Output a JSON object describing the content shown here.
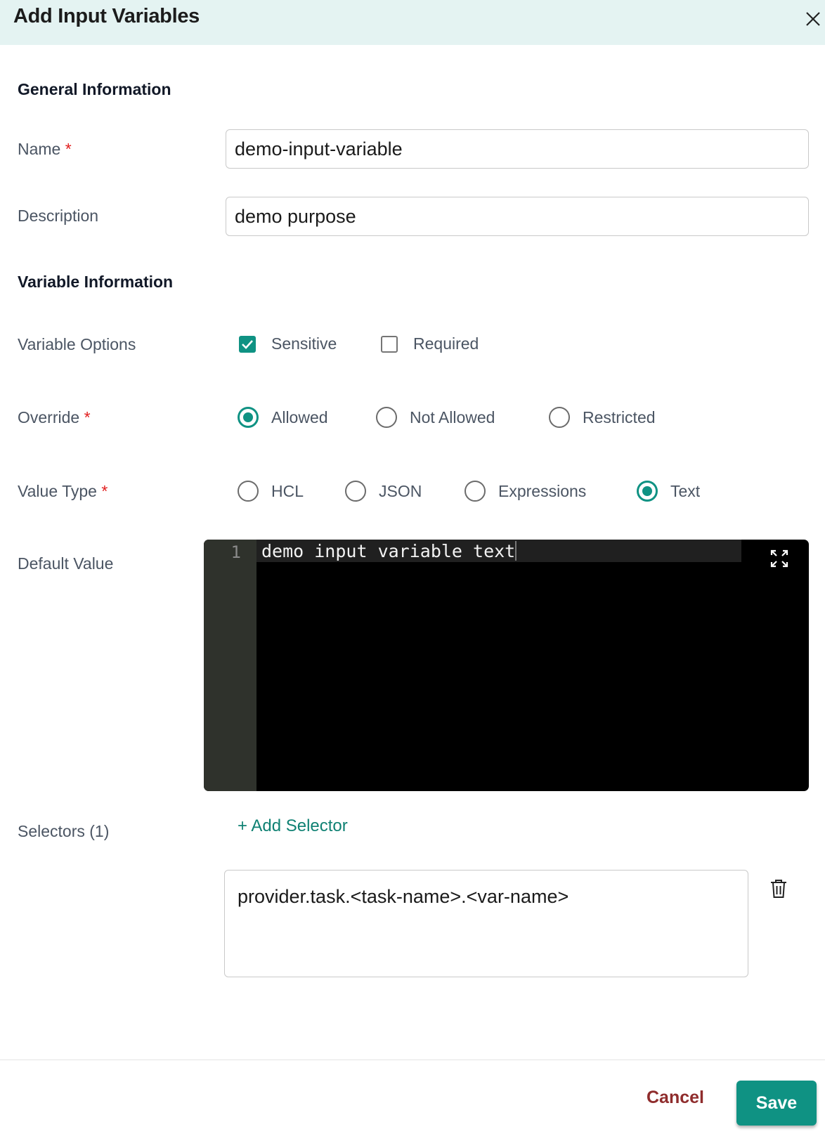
{
  "dialog": {
    "title": "Add Input Variables"
  },
  "general": {
    "heading": "General Information",
    "name_label": "Name",
    "name_value": "demo-input-variable",
    "description_label": "Description",
    "description_value": "demo purpose"
  },
  "variable": {
    "heading": "Variable Information",
    "options_label": "Variable Options",
    "options": [
      {
        "label": "Sensitive",
        "checked": true
      },
      {
        "label": "Required",
        "checked": false
      }
    ],
    "override_label": "Override",
    "override_options": [
      {
        "label": "Allowed",
        "selected": true
      },
      {
        "label": "Not Allowed",
        "selected": false
      },
      {
        "label": "Restricted",
        "selected": false
      }
    ],
    "value_type_label": "Value Type",
    "value_type_options": [
      {
        "label": "HCL",
        "selected": false
      },
      {
        "label": "JSON",
        "selected": false
      },
      {
        "label": "Expressions",
        "selected": false
      },
      {
        "label": "Text",
        "selected": true
      }
    ],
    "default_value_label": "Default Value",
    "editor": {
      "line_number": "1",
      "code": "demo input variable text"
    }
  },
  "selectors": {
    "label": "Selectors (1)",
    "add_label": "+ Add Selector",
    "items": [
      {
        "value": "provider.task.<task-name>.<var-name>"
      }
    ]
  },
  "required_mark": "*",
  "footer": {
    "cancel_label": "Cancel",
    "save_label": "Save"
  },
  "colors": {
    "accent": "#0f9283",
    "cancel": "#8f2c2c",
    "header_bg": "#e4f3f2",
    "required": "#e11d1d"
  }
}
